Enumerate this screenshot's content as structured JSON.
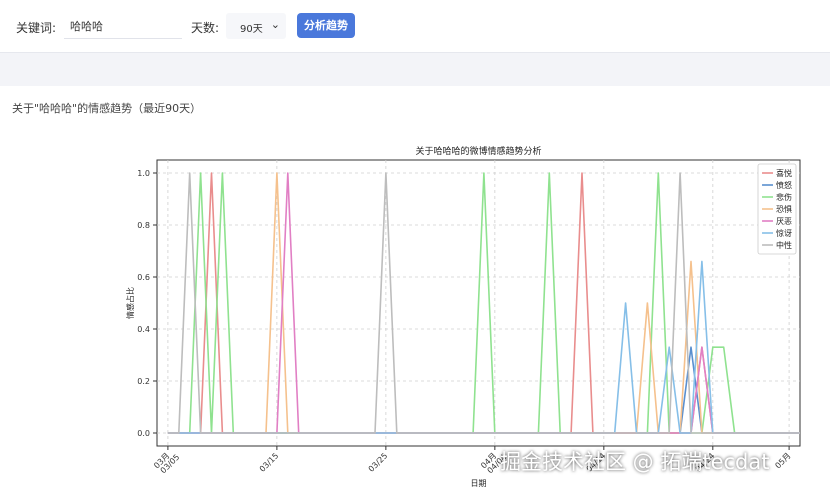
{
  "controls": {
    "keyword_label": "关键词:",
    "keyword_value": "哈哈哈",
    "days_label": "天数:",
    "days_value": "90天",
    "analyze_button": "分析趋势"
  },
  "result": {
    "title": "关于\"哈哈哈\"的情感趋势（最近90天）"
  },
  "watermark": "掘金技术社区 @ 拓端tecdat",
  "chart_data": {
    "type": "line",
    "title": "关于哈哈哈的微博情感趋势分析",
    "xlabel": "日期",
    "ylabel": "情感占比",
    "xlim": [
      "03/04",
      "05/02"
    ],
    "ylim": [
      -0.05,
      1.05
    ],
    "yticks": [
      "0.0",
      "0.2",
      "0.4",
      "0.6",
      "0.8",
      "1.0"
    ],
    "xticks": [
      {
        "date": "03/05",
        "label1": "03月",
        "label2": "03/05"
      },
      {
        "date": "03/15",
        "label1": "03/15",
        "label2": ""
      },
      {
        "date": "03/25",
        "label1": "03/25",
        "label2": ""
      },
      {
        "date": "04/04",
        "label1": "04月",
        "label2": "04/04"
      },
      {
        "date": "04/14",
        "label1": "04/14",
        "label2": ""
      },
      {
        "date": "04/24",
        "label1": "04/24",
        "label2": ""
      },
      {
        "date": "05/01",
        "label1": "05月",
        "label2": ""
      }
    ],
    "grid": true,
    "legend": "top-right",
    "series": [
      {
        "name": "喜悦",
        "color": "#e98d8d",
        "points": [
          [
            "03/05",
            0
          ],
          [
            "03/08",
            0
          ],
          [
            "03/09",
            1
          ],
          [
            "03/10",
            0
          ],
          [
            "03/28",
            0
          ],
          [
            "03/29",
            0
          ],
          [
            "04/11",
            0
          ],
          [
            "04/12",
            1
          ],
          [
            "04/13",
            0
          ],
          [
            "04/22",
            0
          ],
          [
            "04/23",
            0.33
          ],
          [
            "04/24",
            0
          ],
          [
            "05/02",
            0
          ]
        ]
      },
      {
        "name": "愤怒",
        "color": "#5a8fcf",
        "points": [
          [
            "03/05",
            0
          ],
          [
            "04/21",
            0
          ],
          [
            "04/22",
            0.33
          ],
          [
            "04/23",
            0
          ],
          [
            "05/02",
            0
          ]
        ]
      },
      {
        "name": "悲伤",
        "color": "#8fe28f",
        "points": [
          [
            "03/05",
            0
          ],
          [
            "03/07",
            0
          ],
          [
            "03/08",
            1
          ],
          [
            "03/09",
            0
          ],
          [
            "03/10",
            1
          ],
          [
            "03/11",
            0
          ],
          [
            "04/02",
            0
          ],
          [
            "04/03",
            1
          ],
          [
            "04/04",
            0
          ],
          [
            "04/08",
            0
          ],
          [
            "04/09",
            1
          ],
          [
            "04/10",
            0
          ],
          [
            "04/18",
            0
          ],
          [
            "04/19",
            1
          ],
          [
            "04/20",
            0
          ],
          [
            "04/23",
            0
          ],
          [
            "04/24",
            0.33
          ],
          [
            "04/25",
            0.33
          ],
          [
            "04/26",
            0
          ],
          [
            "05/02",
            0
          ]
        ]
      },
      {
        "name": "恐惧",
        "color": "#f5c18d",
        "points": [
          [
            "03/05",
            0
          ],
          [
            "03/14",
            0
          ],
          [
            "03/15",
            1
          ],
          [
            "03/16",
            0
          ],
          [
            "04/17",
            0
          ],
          [
            "04/18",
            0.5
          ],
          [
            "04/19",
            0
          ],
          [
            "04/21",
            0
          ],
          [
            "04/22",
            0.66
          ],
          [
            "04/23",
            0
          ],
          [
            "05/02",
            0
          ]
        ]
      },
      {
        "name": "厌恶",
        "color": "#e17fc4",
        "points": [
          [
            "03/05",
            0
          ],
          [
            "03/15",
            0
          ],
          [
            "03/16",
            1
          ],
          [
            "03/17",
            0
          ],
          [
            "04/22",
            0
          ],
          [
            "04/23",
            0.33
          ],
          [
            "04/24",
            0
          ],
          [
            "05/02",
            0
          ]
        ]
      },
      {
        "name": "惊讶",
        "color": "#86bfe8",
        "points": [
          [
            "03/05",
            0
          ],
          [
            "04/15",
            0
          ],
          [
            "04/16",
            0.5
          ],
          [
            "04/17",
            0
          ],
          [
            "04/19",
            0
          ],
          [
            "04/20",
            0.33
          ],
          [
            "04/21",
            0
          ],
          [
            "04/22",
            0
          ],
          [
            "04/23",
            0.66
          ],
          [
            "04/24",
            0
          ],
          [
            "05/02",
            0
          ]
        ]
      },
      {
        "name": "中性",
        "color": "#bdbdbd",
        "points": [
          [
            "03/05",
            0
          ],
          [
            "03/06",
            0
          ],
          [
            "03/07",
            1
          ],
          [
            "03/08",
            0
          ],
          [
            "03/15",
            0
          ],
          [
            "03/16",
            0
          ],
          [
            "03/24",
            0
          ],
          [
            "03/25",
            1
          ],
          [
            "03/26",
            0
          ],
          [
            "04/20",
            0
          ],
          [
            "04/21",
            1
          ],
          [
            "04/22",
            0
          ],
          [
            "05/02",
            0
          ]
        ]
      }
    ]
  }
}
